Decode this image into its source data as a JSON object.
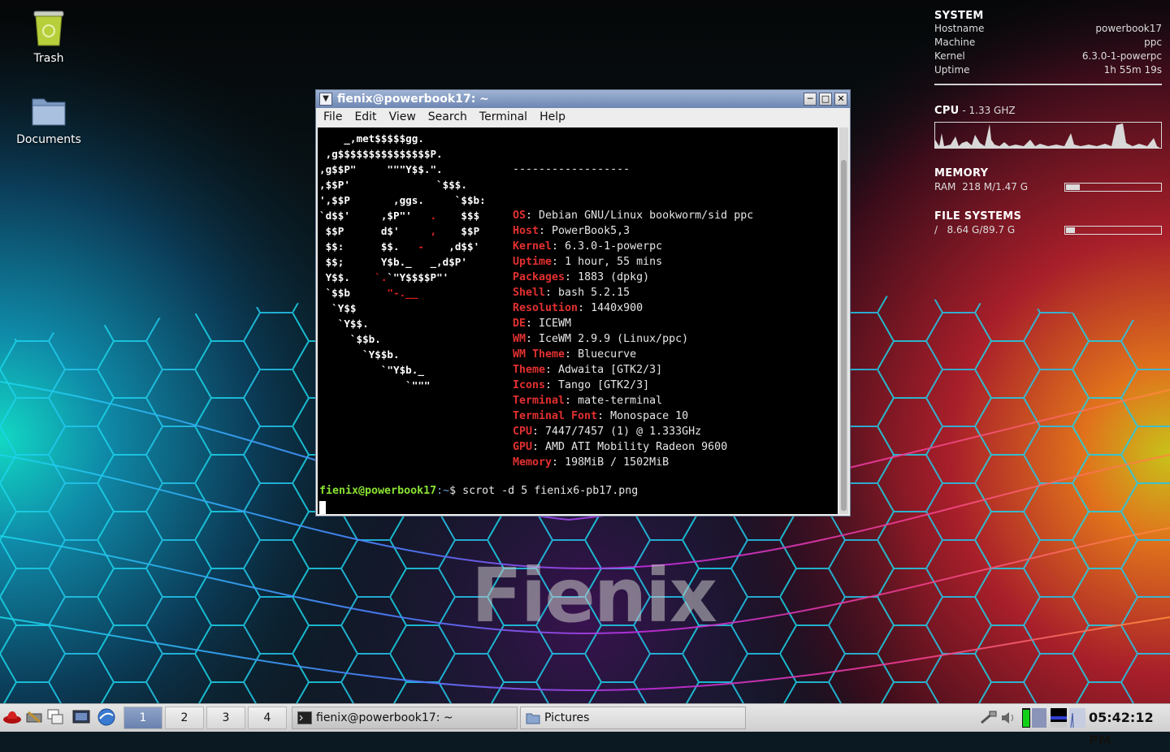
{
  "desktop": {
    "icons": [
      {
        "label": "Trash",
        "icon": "trash-icon"
      },
      {
        "label": "Documents",
        "icon": "folder-icon"
      }
    ],
    "watermark": "Fienix"
  },
  "conky": {
    "system": {
      "heading": "SYSTEM",
      "rows": [
        {
          "label": "Hostname",
          "value": "powerbook17"
        },
        {
          "label": "Machine",
          "value": "ppc"
        },
        {
          "label": "Kernel",
          "value": "6.3.0-1-powerpc"
        },
        {
          "label": "Uptime",
          "value": "1h 55m 19s"
        }
      ]
    },
    "cpu": {
      "heading": "CPU",
      "freq": " - 1.33 GHZ"
    },
    "memory": {
      "heading": "MEMORY",
      "label": "RAM",
      "value": "218 M/1.47 G",
      "fraction": 0.145
    },
    "filesystems": {
      "heading": "FILE SYSTEMS",
      "label": "/",
      "value": "8.64 G/89.7 G",
      "fraction": 0.096
    }
  },
  "terminal": {
    "title": "fienix@powerbook17: ~",
    "menu": [
      "File",
      "Edit",
      "View",
      "Search",
      "Terminal",
      "Help"
    ],
    "separator": "------------------",
    "info": [
      {
        "key": "OS",
        "value": "Debian GNU/Linux bookworm/sid ppc"
      },
      {
        "key": "Host",
        "value": "PowerBook5,3"
      },
      {
        "key": "Kernel",
        "value": "6.3.0-1-powerpc"
      },
      {
        "key": "Uptime",
        "value": "1 hour, 55 mins"
      },
      {
        "key": "Packages",
        "value": "1883 (dpkg)"
      },
      {
        "key": "Shell",
        "value": "bash 5.2.15"
      },
      {
        "key": "Resolution",
        "value": "1440x900"
      },
      {
        "key": "DE",
        "value": "ICEWM"
      },
      {
        "key": "WM",
        "value": "IceWM 2.9.9 (Linux/ppc)"
      },
      {
        "key": "WM Theme",
        "value": "Bluecurve"
      },
      {
        "key": "Theme",
        "value": "Adwaita [GTK2/3]"
      },
      {
        "key": "Icons",
        "value": "Tango [GTK2/3]"
      },
      {
        "key": "Terminal",
        "value": "mate-terminal"
      },
      {
        "key": "Terminal Font",
        "value": "Monospace 10"
      },
      {
        "key": "CPU",
        "value": "7447/7457 (1) @ 1.333GHz"
      },
      {
        "key": "GPU",
        "value": "AMD ATI Mobility Radeon 9600"
      },
      {
        "key": "Memory",
        "value": "198MiB / 1502MiB"
      }
    ],
    "palette_top": [
      "#2e2e2e",
      "#cc0000",
      "#4e9a06",
      "#c4a000",
      "#3465a4",
      "#75507b",
      "#06989a",
      "#d3d7cf"
    ],
    "palette_bottom": [
      "#555753",
      "#ef2929",
      "#8ae234",
      "#fce94f",
      "#729fcf",
      "#ad7fa8",
      "#34e2e2",
      "#eeeeec"
    ],
    "prompt_user": "fienix@powerbook17",
    "prompt_path": ":~",
    "prompt_symbol": "$ ",
    "command": "scrot -d 5 fienix6-pb17.png"
  },
  "taskbar": {
    "workspaces": [
      "1",
      "2",
      "3",
      "4"
    ],
    "active_workspace": "1",
    "tasks": [
      {
        "label": "fienix@powerbook17: ~",
        "icon": "terminal-icon"
      },
      {
        "label": "Pictures",
        "icon": "folder-icon"
      }
    ],
    "clock": "05:42:12 PM"
  }
}
